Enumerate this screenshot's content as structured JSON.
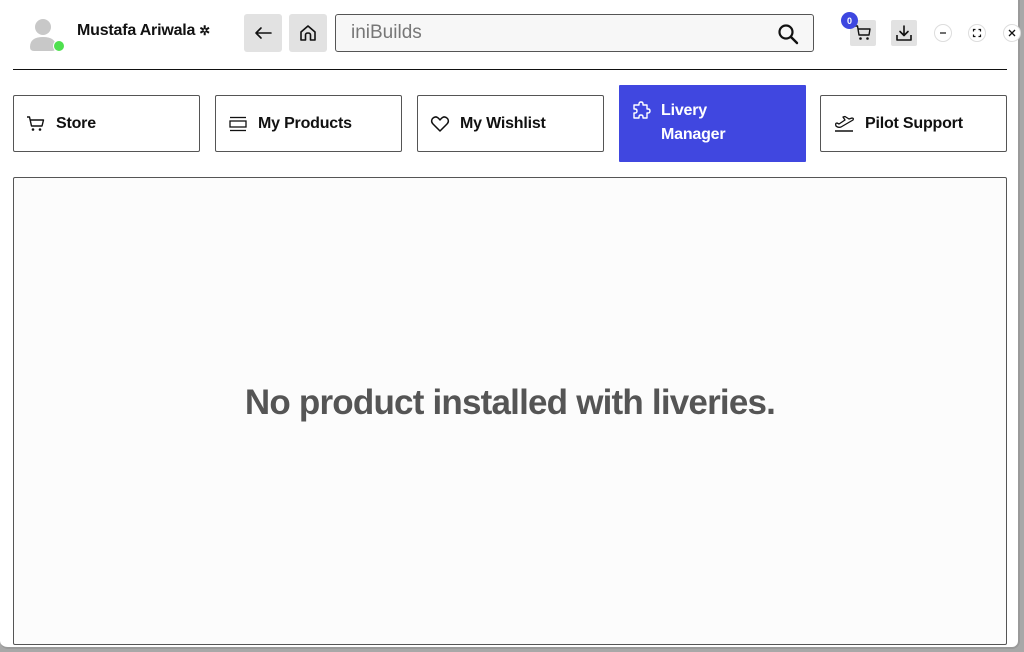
{
  "header": {
    "user_name": "Mustafa Ariwala",
    "user_status": "online",
    "search": {
      "value": "",
      "placeholder": "iniBuilds"
    },
    "cart_count": "0",
    "icons": {
      "avatar": "user-avatar-icon",
      "settings": "gear-icon",
      "back": "arrow-left-icon",
      "home": "home-icon",
      "search": "search-icon",
      "cart": "cart-icon",
      "download": "download-icon",
      "minimize": "minimize-icon",
      "maximize": "maximize-icon",
      "close": "close-icon"
    }
  },
  "tabs": [
    {
      "id": "store",
      "label": "Store",
      "icon": "cart-icon",
      "active": false
    },
    {
      "id": "my-products",
      "label": "My Products",
      "icon": "products-icon",
      "active": false
    },
    {
      "id": "my-wishlist",
      "label": "My Wishlist",
      "icon": "heart-icon",
      "active": false
    },
    {
      "id": "livery-manager",
      "label": "Livery Manager",
      "icon": "puzzle-icon",
      "active": true
    },
    {
      "id": "pilot-support",
      "label": "Pilot Support",
      "icon": "plane-icon",
      "active": false
    }
  ],
  "main": {
    "empty_message": "No product installed with liveries."
  },
  "colors": {
    "accent": "#4047e0",
    "badge": "#3d47e0",
    "online": "#4ee04e",
    "message_text": "#555555"
  }
}
